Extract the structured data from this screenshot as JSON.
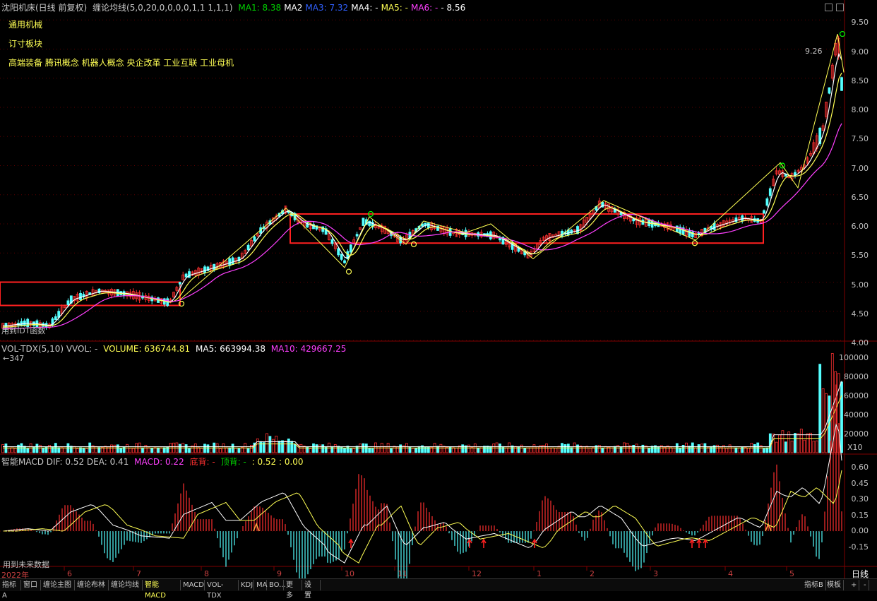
{
  "stock_title": "沈阳机床(日线 前复权)",
  "indicator_main": "缠论均线(5,0,20,0,0,0,0,1,1 1,1,1)",
  "ma_readouts": [
    {
      "label": "MA1: 8.38",
      "color": "#00d000"
    },
    {
      "label": "MA2",
      "color": "#ffffff"
    },
    {
      "label": "MA3: 7.32",
      "color": "#3060ff"
    },
    {
      "label": "MA4: -",
      "color": "#ffffff"
    },
    {
      "label": "MA5: -",
      "color": "#ffff54"
    },
    {
      "label": "MA6: -",
      "color": "#ff40ff"
    },
    {
      "label": "- 8.56",
      "color": "#ffffff"
    }
  ],
  "concepts": [
    "通用机械",
    "订寸板块",
    "高端装备 腾讯概念 机器人概念 央企改革 工业互联 工业母机"
  ],
  "price_axis": [
    "9.50",
    "9.00",
    "8.50",
    "8.00",
    "7.50",
    "7.00",
    "6.50",
    "6.00",
    "5.50",
    "5.00",
    "4.50",
    "4.00"
  ],
  "peak_label": "9.26",
  "main_bottom_note": "用到IDT函数",
  "vol_header": {
    "name": "VOL-TDX(5,10) VVOL: -",
    "volume": "VOLUME: 636744.81",
    "ma5": "MA5: 663994.38",
    "ma10": "MA10: 429667.25"
  },
  "vol_sub": "←347",
  "vol_axis": [
    "100000",
    "80000",
    "60000",
    "40000",
    "20000"
  ],
  "vol_unit": "X10",
  "macd_header": {
    "name": "智能MACD DIF: 0.52 DEA: 0.41",
    "macd": "MACD: 0.22",
    "bottom": "底背: -",
    "top": "顶背: -",
    "tail": ": 0.52 : 0.00"
  },
  "macd_axis": [
    "0.60",
    "0.45",
    "0.30",
    "0.15",
    "0.00",
    "-0.15"
  ],
  "macd_note": "用到未来数据",
  "x_labels": [
    "2022年",
    "6",
    "7",
    "8",
    "9",
    "10",
    "11",
    "12",
    "1",
    "2",
    "3",
    "4",
    "5"
  ],
  "period": "日线",
  "tabs": [
    "指标A",
    "窗口",
    "缠论主图",
    "缠论布林",
    "缠论均线",
    "智能MACD",
    "MACD",
    "VOL-TDX",
    "KDJ",
    "MA",
    "BO...",
    "更多",
    "设置"
  ],
  "tabs_right": [
    "指标B",
    "模板",
    "+",
    "-"
  ],
  "colors": {
    "up": "#ff3030",
    "down": "#54ffff",
    "ma_yellow": "#ffff54",
    "ma_pink": "#ff40ff",
    "box": "#ff2020",
    "bg": "#000000",
    "grid": "#800000"
  },
  "chart_data": {
    "type": "candlestick",
    "price_range": [
      4.0,
      9.6
    ],
    "peak": 9.26,
    "boxes": [
      {
        "low": 4.6,
        "high": 5.0
      },
      {
        "low": 5.67,
        "high": 6.17
      }
    ]
  }
}
